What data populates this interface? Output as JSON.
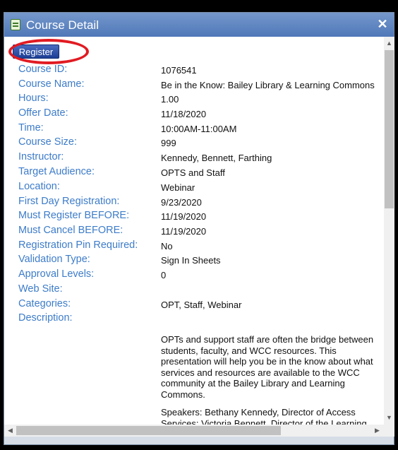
{
  "window": {
    "title": "Course Detail",
    "close_glyph": "✕",
    "title_icon": "form-icon"
  },
  "register_label": "Register",
  "fields": {
    "course_id": {
      "label": "Course ID:",
      "value": "1076541"
    },
    "course_name": {
      "label": "Course Name:",
      "value": "Be in the Know: Bailey Library & Learning Commons"
    },
    "hours": {
      "label": "Hours:",
      "value": "1.00"
    },
    "offer_date": {
      "label": "Offer Date:",
      "value": "11/18/2020"
    },
    "time": {
      "label": "Time:",
      "value": "10:00AM-11:00AM"
    },
    "course_size": {
      "label": "Course Size:",
      "value": "999"
    },
    "instructor": {
      "label": "Instructor:",
      "value": "Kennedy, Bennett, Farthing"
    },
    "target_audience": {
      "label": "Target Audience:",
      "value": "OPTS and Staff"
    },
    "location": {
      "label": "Location:",
      "value": "Webinar"
    },
    "first_day_registration": {
      "label": "First Day Registration:",
      "value": "9/23/2020"
    },
    "must_register_before": {
      "label": "Must Register BEFORE:",
      "value": "11/19/2020"
    },
    "must_cancel_before": {
      "label": "Must Cancel BEFORE:",
      "value": "11/19/2020"
    },
    "registration_pin_required": {
      "label": "Registration Pin Required:",
      "value": "No"
    },
    "validation_type": {
      "label": "Validation Type:",
      "value": "Sign In Sheets"
    },
    "approval_levels": {
      "label": "Approval Levels:",
      "value": "0"
    },
    "web_site": {
      "label": "Web Site:",
      "value": ""
    },
    "categories": {
      "label": "Categories:",
      "value": "OPT, Staff, Webinar"
    },
    "description": {
      "label": "Description:",
      "paragraph1": "OPTs and support staff are often the bridge between students, faculty, and WCC resources. This presentation will help you be in the know about what services and resources are available to the WCC community at the Bailey Library and Learning Commons.",
      "paragraph2": "Speakers: Bethany Kennedy, Director of Access Services; Victoria Bennett, Director of the Learning Commons; and Matthew Farthing, Director of"
    }
  },
  "colors": {
    "label": "#3d7cc9",
    "titlebar": "#5a80bd",
    "register_button": "#1d3e95",
    "annotation_circle": "#e11b22"
  }
}
